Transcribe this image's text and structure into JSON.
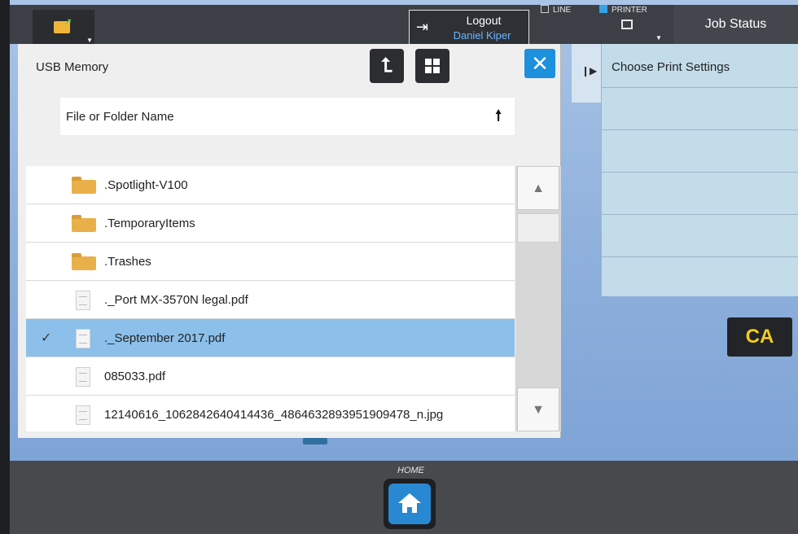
{
  "topbar": {
    "logout_label": "Logout",
    "user_name": "Daniel Kiper",
    "line_label": "LINE",
    "printer_label": "PRINTER",
    "job_status_label": "Job Status"
  },
  "dialog": {
    "title": "USB Memory",
    "sort_column_label": "File or Folder Name",
    "sort_direction_glyph": "🠕",
    "close_glyph": "✕",
    "up_glyph": "⮤",
    "items": [
      {
        "type": "folder",
        "name": ".Spotlight-V100",
        "selected": false
      },
      {
        "type": "folder",
        "name": ".TemporaryItems",
        "selected": false
      },
      {
        "type": "folder",
        "name": ".Trashes",
        "selected": false
      },
      {
        "type": "file",
        "name": "._Port MX-3570N legal.pdf",
        "selected": false
      },
      {
        "type": "file",
        "name": "._September 2017.pdf",
        "selected": true
      },
      {
        "type": "file",
        "name": "085033.pdf",
        "selected": false
      },
      {
        "type": "file",
        "name": "12140616_1062842640414436_4864632893951909478_n.jpg",
        "selected": false
      }
    ]
  },
  "settings": {
    "title": "Choose Print Settings",
    "expand_glyph": "❙▶"
  },
  "ca_label": "CA",
  "home_label": "HOME",
  "colors": {
    "selected_row": "#8cc0ea",
    "close_button": "#1c8fdd",
    "ca_text": "#f5cc1e",
    "user_name": "#6cb7ff"
  },
  "icons": {
    "file_button": "folder-upload-icon",
    "logout": "logout-icon",
    "up_folder": "up-level-icon",
    "grid_view": "grid-view-icon",
    "close": "close-icon",
    "sort": "sort-ascending-icon",
    "checkmark": "checkmark-icon",
    "folder": "folder-icon",
    "document": "document-icon",
    "scroll_up": "scroll-up-icon",
    "scroll_down": "scroll-down-icon",
    "home": "home-icon"
  }
}
